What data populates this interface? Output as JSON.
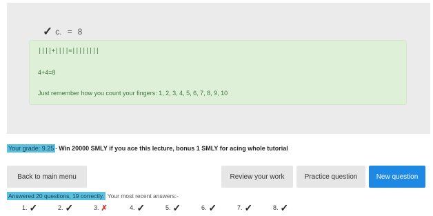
{
  "question": {
    "selected_answer_prefix": "c.",
    "equals": "=",
    "selected_answer_value": "8"
  },
  "explanation": {
    "tally_line": "||||+||||=||||||||",
    "equation_line": "4+4=8",
    "hint_line": "Just remember how you count your fingers: 1, 2, 3, 4, 5, 6, 7, 8, 9, 10"
  },
  "grade": {
    "label": "Your grade: 9.25",
    "separator": "-",
    "promo": "Win 20000 SMLY if you ace this lecture, bonus 1 SMLY for acing whole tutorial"
  },
  "buttons": {
    "back": "Back to main menu",
    "review": "Review your work",
    "practice": "Practice question",
    "new": "New question"
  },
  "stats": {
    "answered": "Answered 20 questions, 19 correctly.",
    "recent_label": "Your most recent answers:-"
  },
  "recent_answers": [
    {
      "num": "1.",
      "mark": "✓",
      "correct": true
    },
    {
      "num": "2.",
      "mark": "✓",
      "correct": true
    },
    {
      "num": "3.",
      "mark": "✗",
      "correct": false
    },
    {
      "num": "4.",
      "mark": "✓",
      "correct": true
    },
    {
      "num": "5.",
      "mark": "✓",
      "correct": true
    },
    {
      "num": "6.",
      "mark": "✓",
      "correct": true
    },
    {
      "num": "7.",
      "mark": "✓",
      "correct": true
    },
    {
      "num": "8.",
      "mark": "✓",
      "correct": true
    }
  ],
  "colors": {
    "primary": "#1e88e5",
    "highlight": "#5bc0de",
    "success_bg": "#dff0d8",
    "wrong": "#d32f2f"
  }
}
